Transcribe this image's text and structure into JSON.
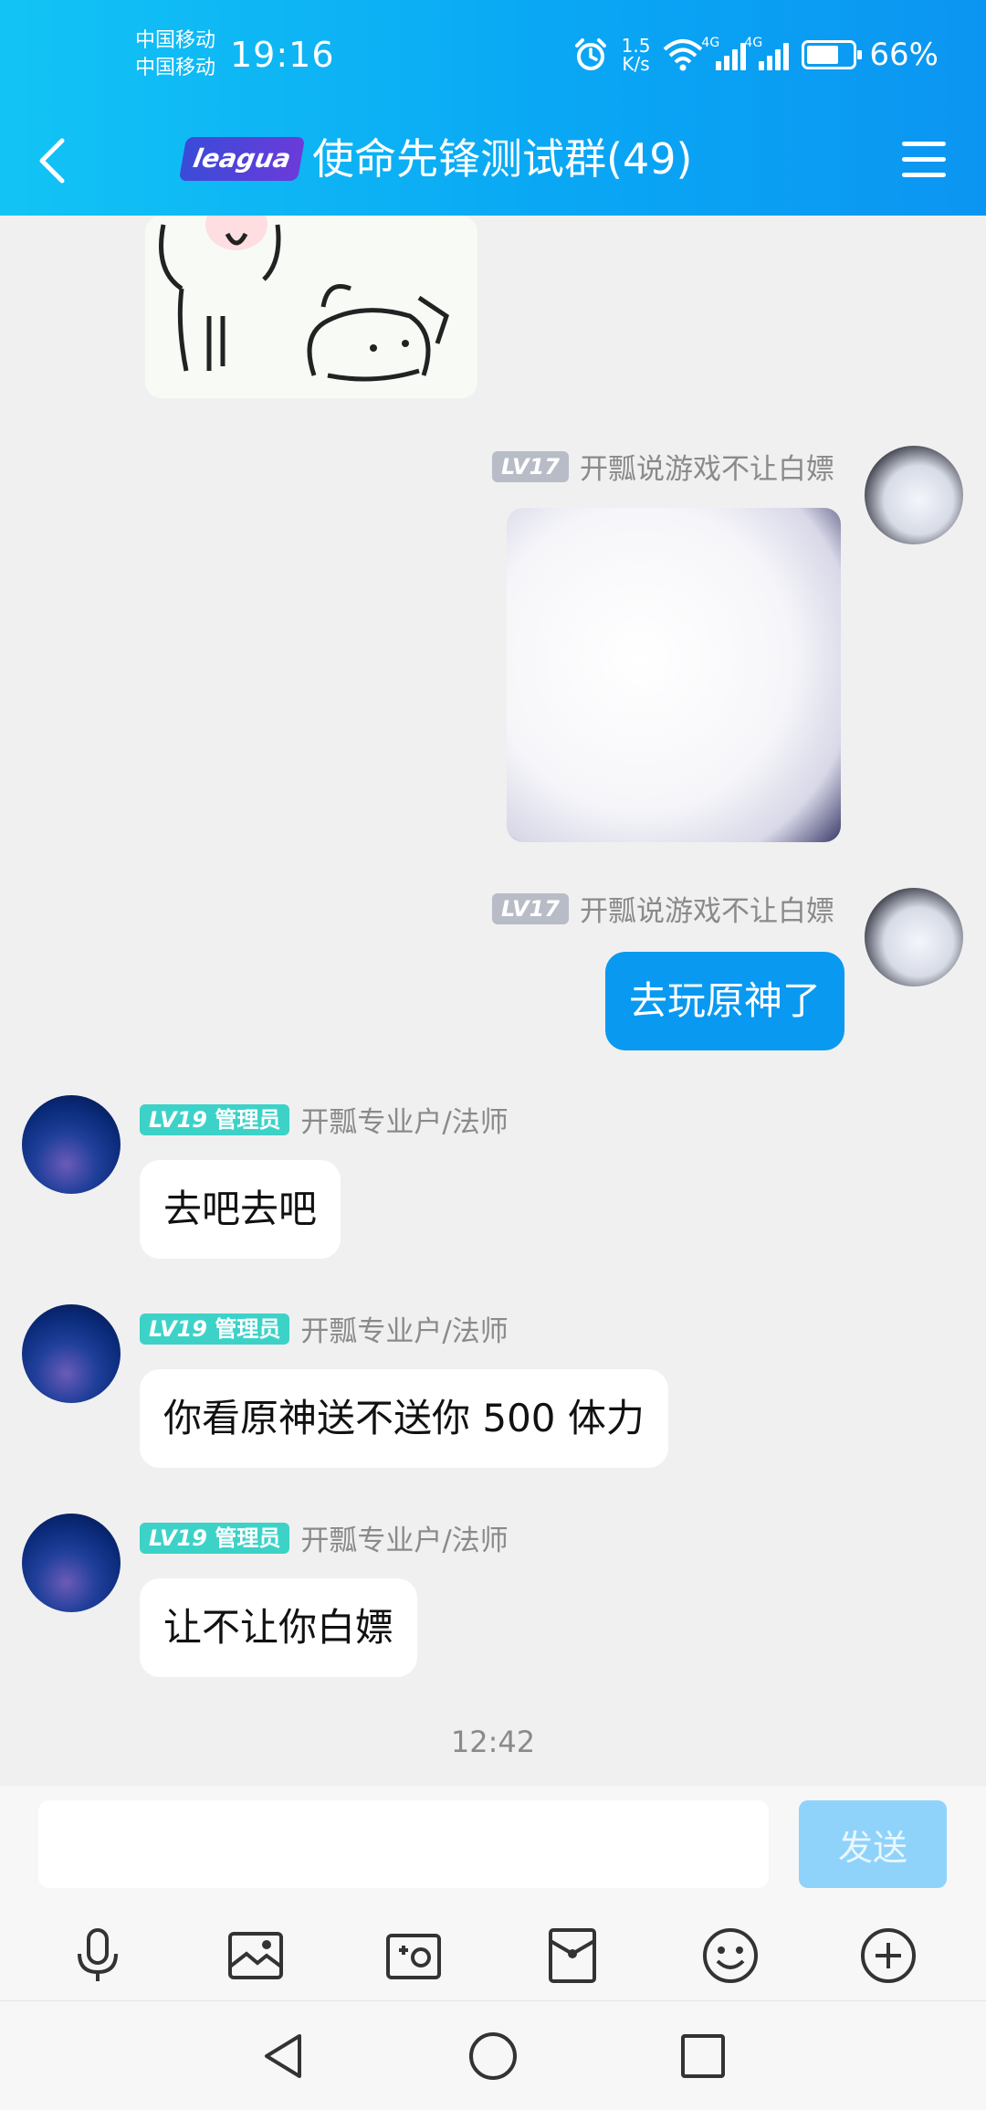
{
  "status_bar": {
    "carrier_1": "中国移动",
    "carrier_2": "中国移动",
    "time": "19:16",
    "net_speed_value": "1.5",
    "net_speed_unit": "K/s",
    "sim1_type": "4G",
    "sim2_type": "4G",
    "battery": "66%",
    "icons": [
      "alarm-icon",
      "wifi-icon",
      "signal-icon",
      "battery-icon"
    ]
  },
  "header": {
    "group_logo": "leagua",
    "title": "使命先锋测试群(49)",
    "back_icon": "chevron-left-icon",
    "menu_icon": "hamburger-menu-icon"
  },
  "messages": [
    {
      "type": "sticker",
      "side": "left"
    },
    {
      "type": "sticker",
      "side": "right",
      "level": "LV17",
      "name": "开瓢说游戏不让白嫖"
    },
    {
      "type": "text",
      "side": "right",
      "level": "LV17",
      "name": "开瓢说游戏不让白嫖",
      "text": "去玩原神了"
    },
    {
      "type": "text",
      "side": "left",
      "level": "LV19",
      "role": "管理员",
      "name": "开瓢专业户/法师",
      "text": "去吧去吧"
    },
    {
      "type": "text",
      "side": "left",
      "level": "LV19",
      "role": "管理员",
      "name": "开瓢专业户/法师",
      "text": "你看原神送不送你 500 体力"
    },
    {
      "type": "text",
      "side": "left",
      "level": "LV19",
      "role": "管理员",
      "name": "开瓢专业户/法师",
      "text": "让不让你白嫖"
    }
  ],
  "timestamp": "12:42",
  "input": {
    "value": "",
    "placeholder": "",
    "send_label": "发送"
  },
  "toolbar_icons": [
    "microphone-icon",
    "image-icon",
    "camera-icon",
    "red-packet-icon",
    "emoji-icon",
    "plus-icon"
  ],
  "nav_icons": [
    "back-triangle-icon",
    "home-circle-icon",
    "recents-square-icon"
  ],
  "colors": {
    "header_blue": "#12c4f5",
    "bubble_blue": "#0a99f1",
    "admin_badge": "#3dd2c8",
    "send_disabled": "#8fd3fb"
  }
}
